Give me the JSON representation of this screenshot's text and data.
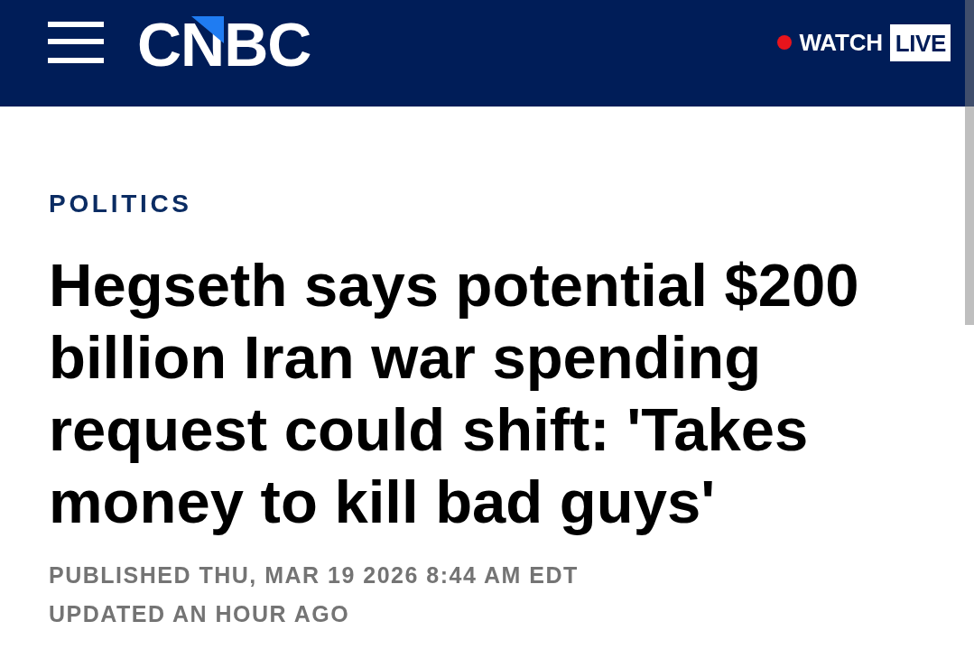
{
  "header": {
    "logo": "CNBC",
    "watch": {
      "label": "WATCH",
      "badge": "LIVE"
    }
  },
  "article": {
    "section": "POLITICS",
    "headline": "Hegseth says potential $200 billion Iran war spending request could shift: 'Takes money to kill bad guys'",
    "published": "PUBLISHED THU, MAR 19 2026 8:44 AM EDT",
    "updated": "UPDATED AN HOUR AGO"
  }
}
